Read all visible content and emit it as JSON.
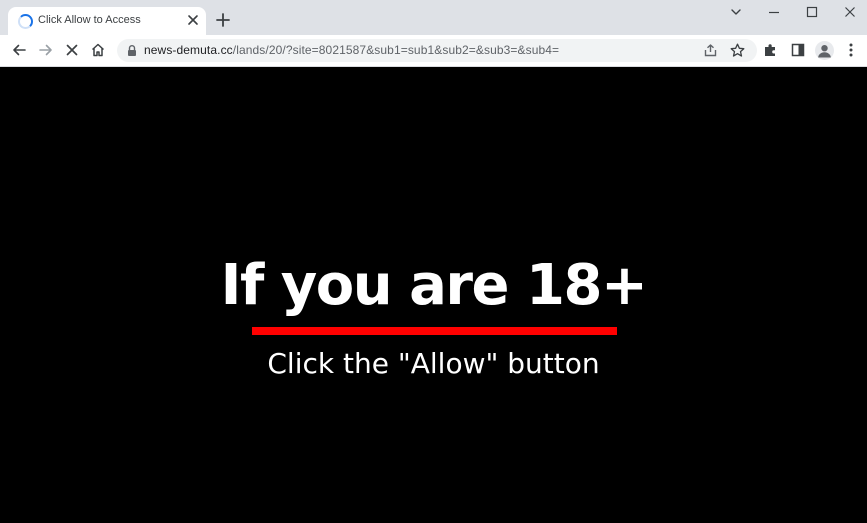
{
  "browser": {
    "tab": {
      "title": "Click Allow to Access",
      "loading": true
    },
    "address_bar": {
      "host": "news-demuta.cc",
      "path": "/lands/20/?site=8021587&sub1=sub1&sub2=&sub3=&sub4="
    },
    "icons": {
      "spinner": "loading-spinner-icon",
      "tab_close": "close-icon",
      "new_tab": "plus-icon",
      "dropdown": "chevron-down-icon",
      "minimize": "minimize-icon",
      "maximize": "maximize-icon",
      "close_window": "close-icon",
      "back": "arrow-left-icon",
      "forward": "arrow-right-icon",
      "stop": "stop-x-icon",
      "home": "home-icon",
      "lock": "lock-icon",
      "share": "share-icon",
      "bookmark": "star-icon",
      "extensions": "puzzle-icon",
      "side_panel": "side-panel-icon",
      "profile": "person-icon",
      "menu": "kebab-menu-icon"
    },
    "colors": {
      "tabstrip": "#dee1e6",
      "accent": "#1a73e8"
    }
  },
  "page": {
    "headline": "If you are 18+",
    "subline": "Click the \"Allow\" button",
    "colors": {
      "background": "#000000",
      "text": "#ffffff",
      "underline": "#ff0000"
    }
  }
}
